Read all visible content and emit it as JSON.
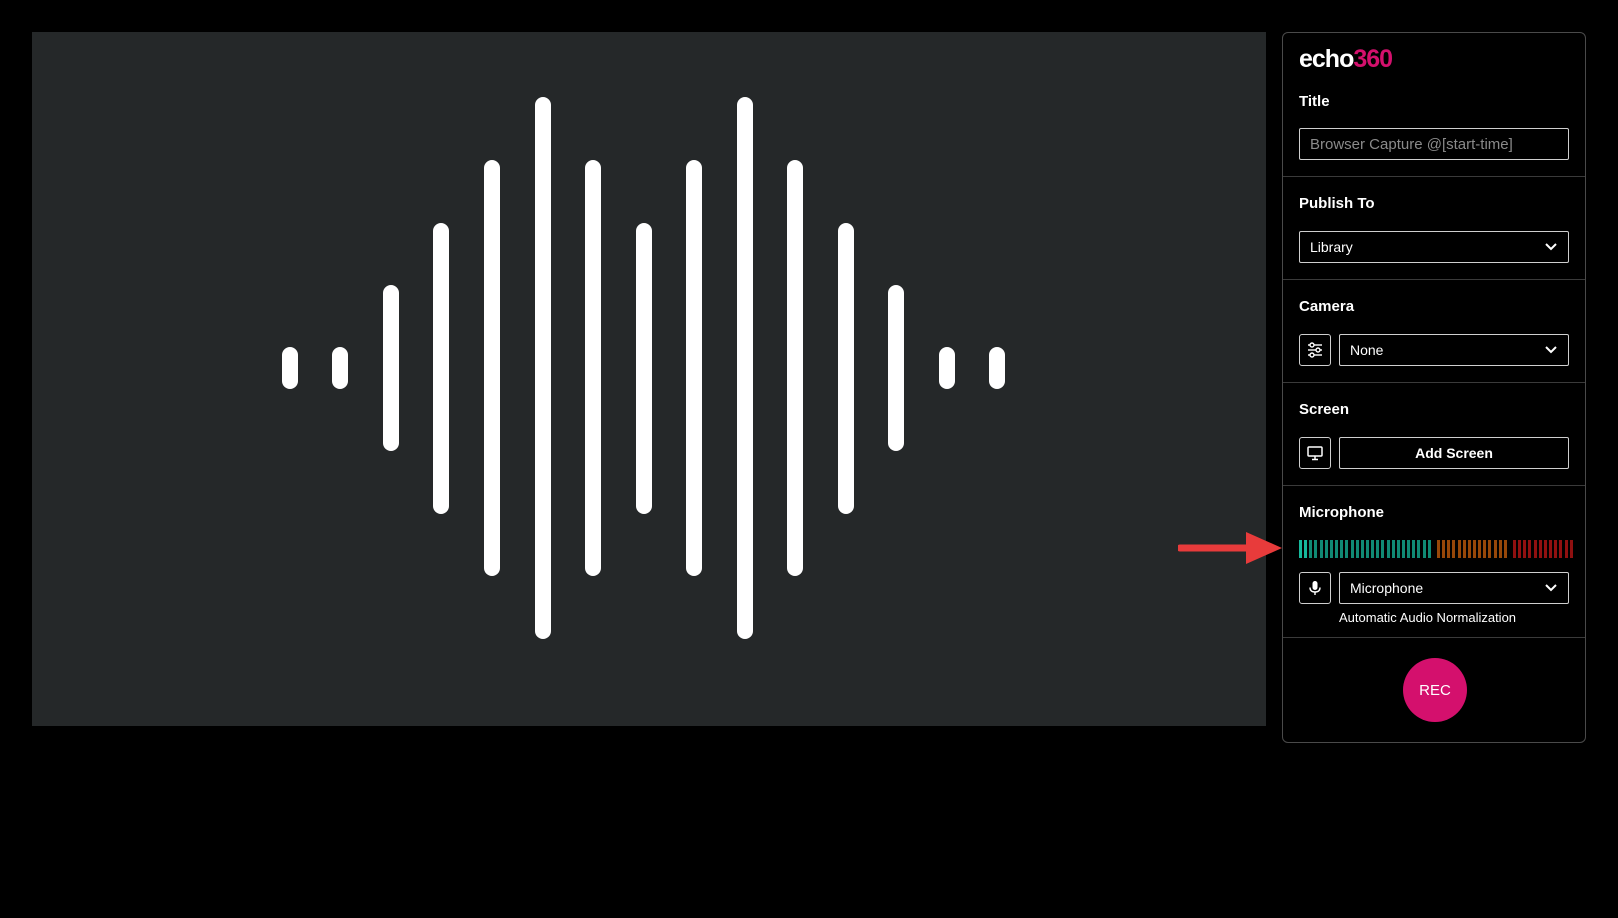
{
  "logo": {
    "echo": "echo",
    "num": "360"
  },
  "title_section": {
    "label": "Title",
    "placeholder": "Browser Capture @[start-time]"
  },
  "publish_section": {
    "label": "Publish To",
    "selected": "Library"
  },
  "camera_section": {
    "label": "Camera",
    "selected": "None"
  },
  "screen_section": {
    "label": "Screen",
    "add_button": "Add Screen"
  },
  "microphone_section": {
    "label": "Microphone",
    "selected": "Microphone",
    "normalization": "Automatic Audio Normalization",
    "level_fraction": 0.02
  },
  "record": {
    "label": "REC"
  },
  "colors": {
    "accent": "#d4106d",
    "meter_green": "#16b89b",
    "meter_orange": "#c95f0c",
    "meter_red": "#c01616",
    "arrow": "#e83b3b"
  }
}
